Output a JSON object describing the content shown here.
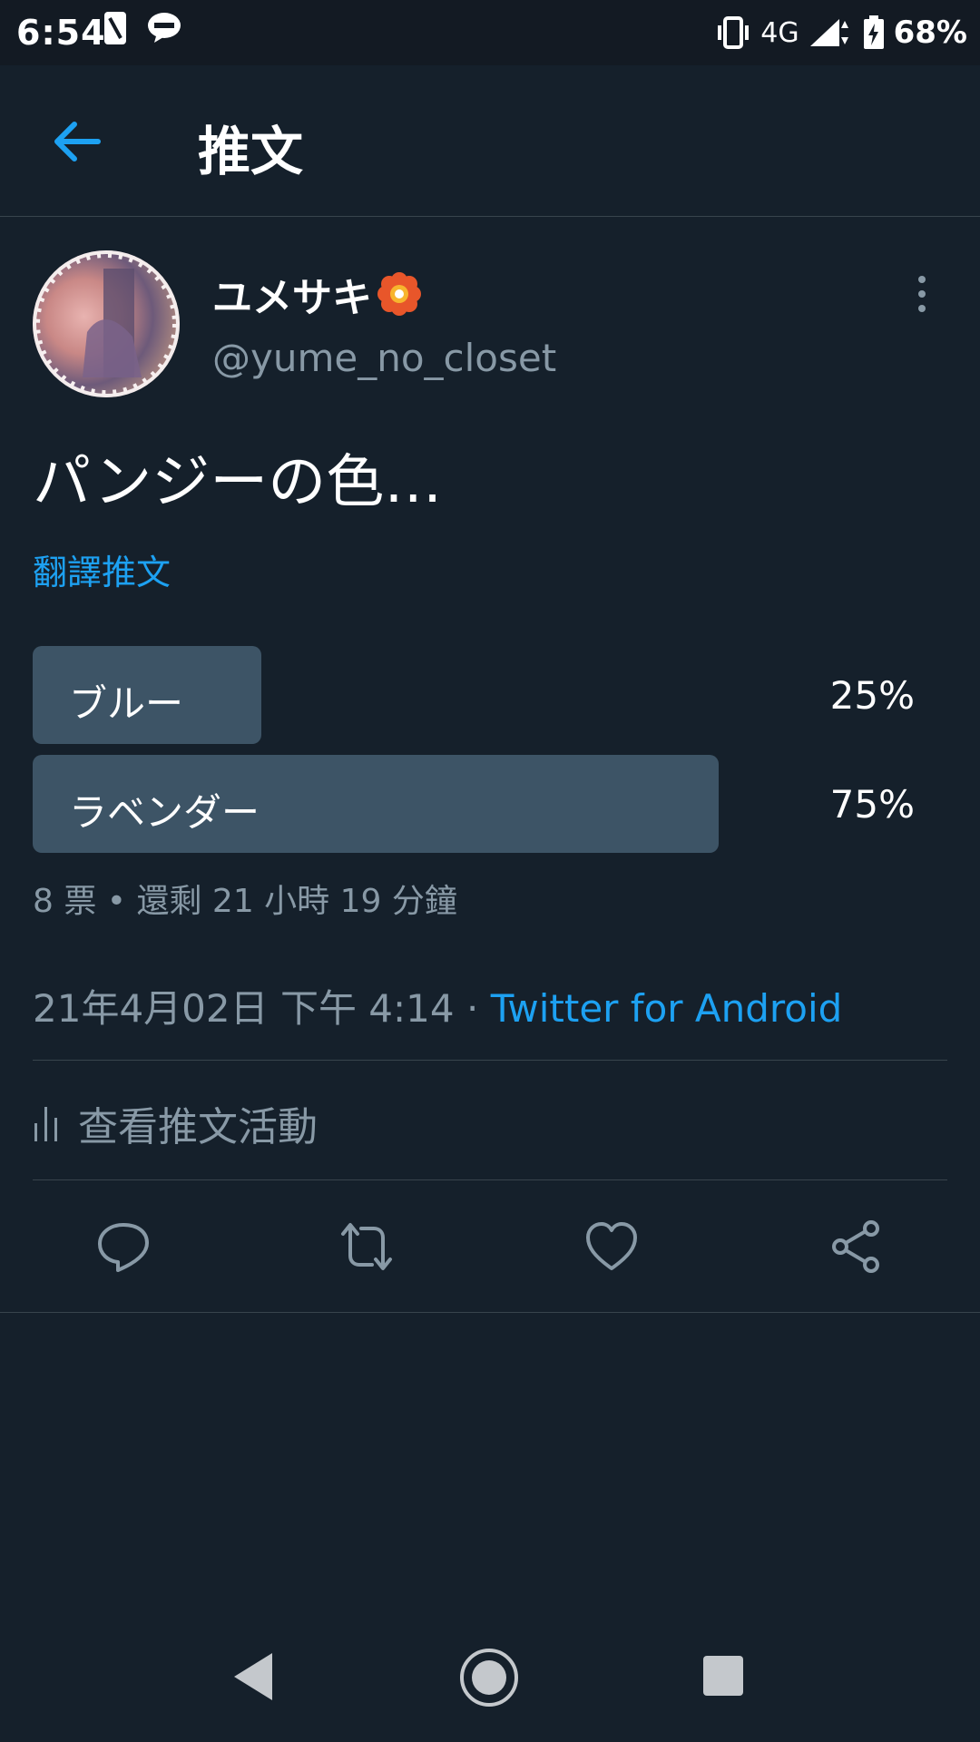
{
  "status_bar": {
    "time": "6:54",
    "network": "4G",
    "battery": "68%"
  },
  "header": {
    "title": "推文"
  },
  "tweet": {
    "display_name": "ユメサキ",
    "handle": "@yume_no_closet",
    "text": "パンジーの色…",
    "translate_label": "翻譯推文",
    "poll": {
      "options": [
        {
          "label": "ブルー",
          "percent": "25%",
          "fraction": 0.25
        },
        {
          "label": "ラベンダー",
          "percent": "75%",
          "fraction": 0.75
        }
      ],
      "meta": "8 票 • 還剩 21 小時 19 分鐘"
    },
    "timestamp": "21年4月02日 下午 4:14 · ",
    "source": "Twitter for Android",
    "activity_label": "查看推文活動"
  },
  "icons": {
    "back": "arrow-left-icon",
    "more": "more-vertical-icon",
    "reply": "reply-icon",
    "retweet": "retweet-icon",
    "like": "heart-icon",
    "share": "share-icon",
    "activity": "bar-chart-icon"
  },
  "colors": {
    "background": "#15202b",
    "accent": "#1da1f2",
    "muted": "#8899a6",
    "poll_bar": "#3d5466"
  }
}
